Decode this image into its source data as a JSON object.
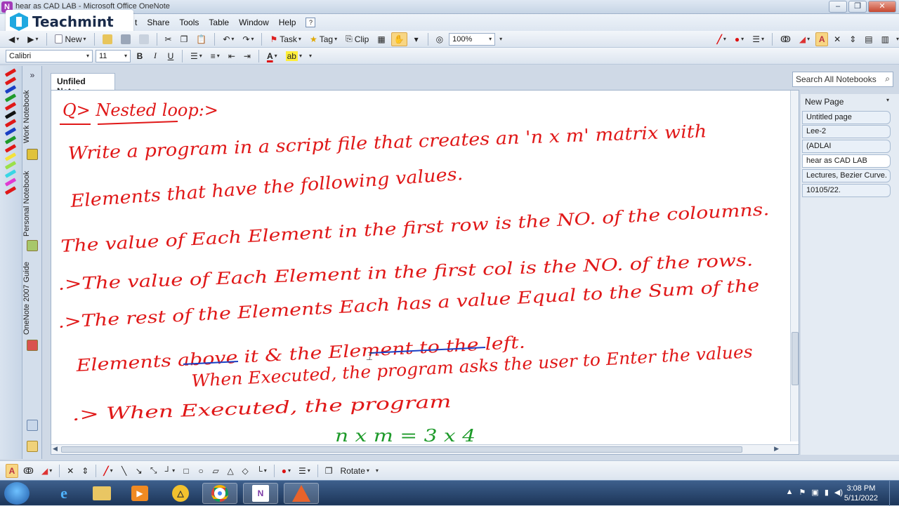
{
  "window": {
    "title": "hear as CAD LAB - Microsoft Office OneNote",
    "minimize": "–",
    "maximize": "❐",
    "close": "✕"
  },
  "watermark": {
    "text": "Teachmint"
  },
  "menu": [
    "t",
    "Share",
    "Tools",
    "Table",
    "Window",
    "Help"
  ],
  "toolbar1": {
    "new_label": "New",
    "task_label": "Task",
    "tag_label": "Tag",
    "clip_label": "Clip",
    "zoom": "100%"
  },
  "toolbar2": {
    "font": "Calibri",
    "size": "11",
    "bold": "B",
    "italic": "I",
    "underline": "U"
  },
  "notebooks": [
    {
      "label": "Work Notebook",
      "color": "#e0c23a"
    },
    {
      "label": "Personal Notebook",
      "color": "#a7c76a"
    },
    {
      "label": "OneNote 2007 Guide",
      "color": "#d9534f"
    }
  ],
  "section_tab": "Unfiled Notes",
  "search": {
    "placeholder": "Search All Notebooks"
  },
  "page_list": {
    "new_page": "New Page",
    "pages": [
      "Untitled page",
      "Lee-2",
      "(ADLAI",
      "hear as CAD LAB",
      "Lectures, Bezier Curve.",
      "10105/22."
    ],
    "selected": "hear as CAD LAB"
  },
  "ink": {
    "heading": "Q> Nested loop:>",
    "lines": [
      "Write a program in a script file that creates an 'n x m' matrix with",
      "Elements that have the following values.",
      "The value of Each Element in the first row is the NO. of the coloumns.",
      ".>The value of Each Element in the first col is the NO. of the rows.",
      ".>The rest of the Elements Each has a value Equal to the Sum of the",
      ".>The rest of the Elements Each has a value Equal to the Sum of the",
      "Elements above it & the Element to the left.",
      "When Executed, the program asks the user to Enter the values",
      ".>  When  Executed,  the program",
      "n x m =  3 x 4"
    ],
    "colors": {
      "red": "#e01818",
      "green": "#1e9a2a",
      "blue": "#1a3fc4"
    }
  },
  "drawbar": {
    "rotate_label": "Rotate"
  },
  "taskbar": {
    "time": "3:08 PM",
    "date": "5/11/2022"
  }
}
